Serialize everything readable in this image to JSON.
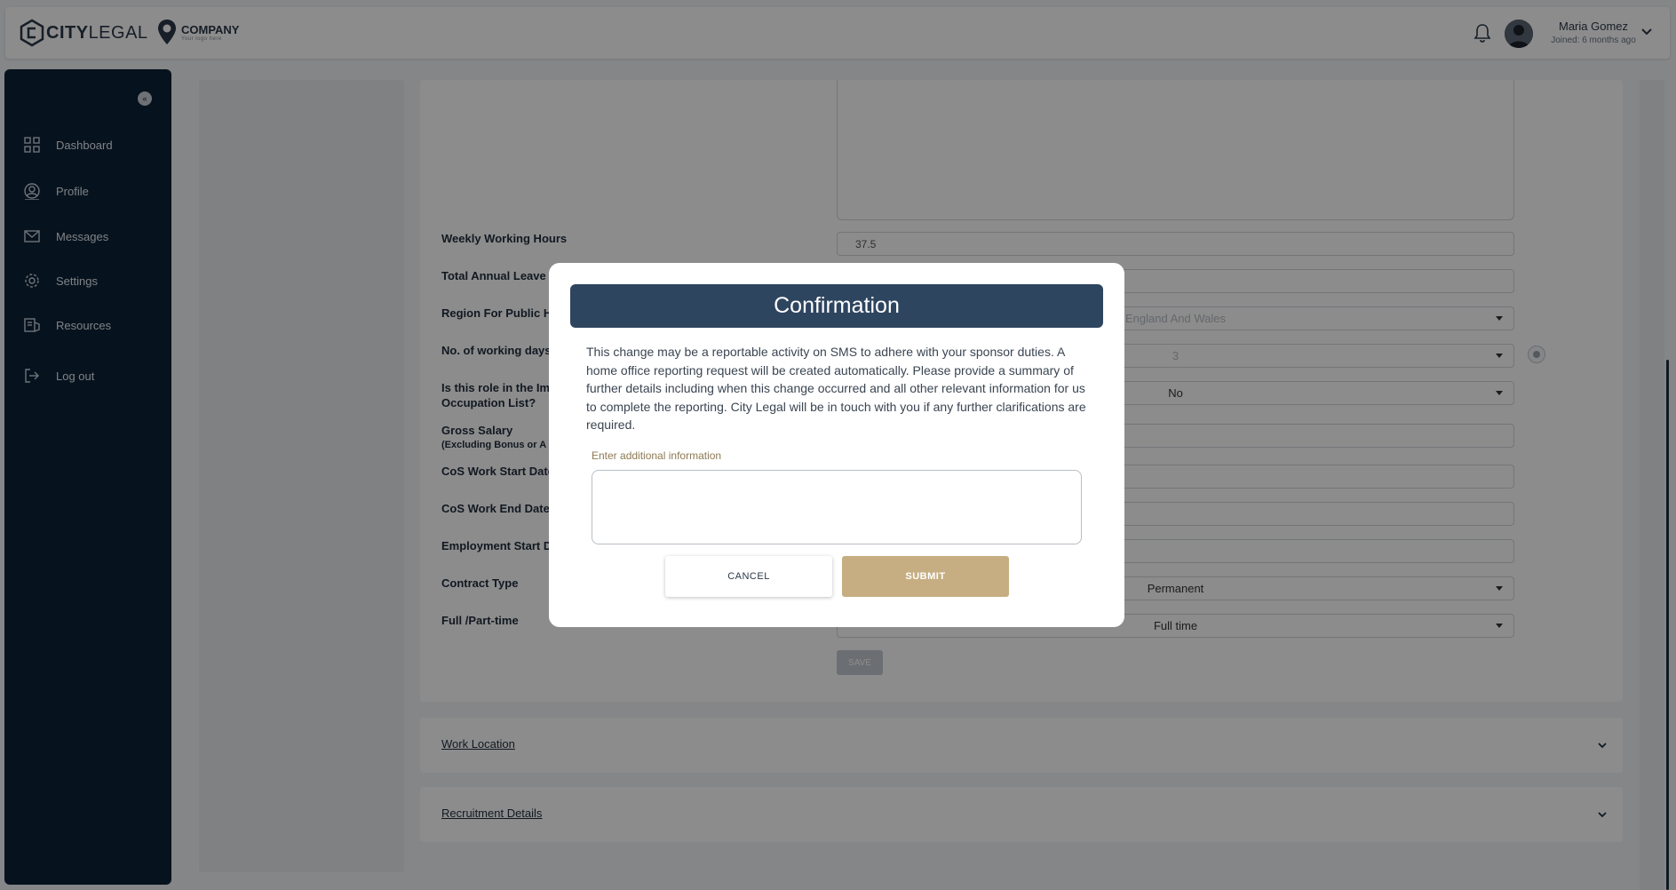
{
  "header": {
    "brand_bold": "CITY",
    "brand_light": "LEGAL",
    "company_name": "COMPANY",
    "company_tagline": "Your logo here",
    "user_name": "Maria Gomez",
    "user_meta": "Joined: 6 months ago"
  },
  "sidebar": {
    "items": [
      {
        "label": "Dashboard",
        "icon": "dashboard-icon"
      },
      {
        "label": "Profile",
        "icon": "profile-icon"
      },
      {
        "label": "Messages",
        "icon": "mail-icon"
      },
      {
        "label": "Settings",
        "icon": "gear-icon"
      },
      {
        "label": "Resources",
        "icon": "resources-icon"
      },
      {
        "label": "Log out",
        "icon": "logout-icon"
      }
    ]
  },
  "form": {
    "weekly_hours_label": "Weekly Working Hours",
    "weekly_hours_value": "37.5",
    "annual_leave_label": "Total Annual Leave",
    "region_label": "Region For Public H",
    "region_value": "England And Wales",
    "working_days_label": "No. of working days",
    "working_days_value": "3",
    "role_list_label_1": "Is this role in the Im",
    "role_list_label_2": "Occupation List?",
    "role_list_value": "No",
    "gross_salary_label": "Gross Salary",
    "gross_salary_sub": "(Excluding Bonus or A",
    "cos_start_label": "CoS Work Start Date",
    "cos_end_label": "CoS Work End Date",
    "employment_start_label": "Employment Start D",
    "contract_type_label": "Contract Type",
    "contract_type_value": "Permanent",
    "full_part_label": "Full /Part-time",
    "full_part_value": "Full time",
    "save_label": "SAVE"
  },
  "accordions": [
    {
      "title": "Work Location"
    },
    {
      "title": "Recruitment Details"
    }
  ],
  "modal": {
    "title": "Confirmation",
    "body": "This change may be a reportable activity on SMS to adhere with your sponsor duties. A home office reporting request will be created automatically. Please provide a summary of further details including when this change occurred and all other relevant information for us to complete the reporting. City Legal will be in touch with you if any further clarifications are required.",
    "input_label": "Enter additional information",
    "input_value": "",
    "cancel_label": "CANCEL",
    "submit_label": "SUBMIT"
  },
  "colors": {
    "sidebar_bg": "#0c2238",
    "modal_header": "#2e4560",
    "submit_button": "#c6ae82"
  }
}
